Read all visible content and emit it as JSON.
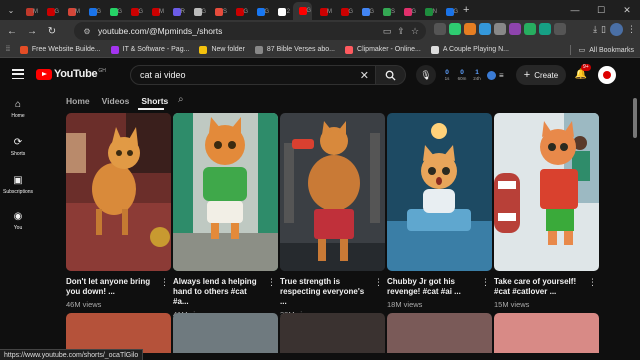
{
  "browser": {
    "tabs": [
      {
        "color": "#c0392b",
        "badge": "M"
      },
      {
        "color": "#cc0000",
        "badge": "G"
      },
      {
        "color": "#d44638",
        "badge": "M"
      },
      {
        "color": "#1a73e8",
        "badge": "G"
      },
      {
        "color": "#25d366",
        "badge": "G"
      },
      {
        "color": "#cc0000",
        "badge": "G"
      },
      {
        "color": "#cc0000",
        "badge": "M"
      },
      {
        "color": "#6c5ce7",
        "badge": "R"
      },
      {
        "color": "#bbbbbb",
        "badge": "G"
      },
      {
        "color": "#e74c3c",
        "badge": "S"
      },
      {
        "color": "#cc0000",
        "badge": "G"
      },
      {
        "color": "#1877f2",
        "badge": "G"
      },
      {
        "color": "#ffffff",
        "badge": "2"
      },
      {
        "color": "#ff0000",
        "badge": "G",
        "active": true
      },
      {
        "color": "#cc0000",
        "badge": "M"
      },
      {
        "color": "#cc0000",
        "badge": "G"
      },
      {
        "color": "#4285f4",
        "badge": "G"
      },
      {
        "color": "#34a853",
        "badge": "S"
      },
      {
        "color": "#e1306c",
        "badge": "G"
      },
      {
        "color": "#1e8e3e",
        "badge": "N"
      },
      {
        "color": "#1a73e8",
        "badge": "G"
      }
    ],
    "url": "youtube.com/@Mpminds_/shorts",
    "bookmarks": [
      {
        "label": "Free Website Builde...",
        "color": "#e44d26"
      },
      {
        "label": "IT & Software - Pag...",
        "color": "#a435f0"
      },
      {
        "label": "New folder",
        "color": "#f4c20d"
      },
      {
        "label": "87 Bible Verses abo...",
        "color": "#888888"
      },
      {
        "label": "Clipmaker - Online...",
        "color": "#ff5a5f"
      },
      {
        "label": "A Couple Playing N...",
        "color": "#dddddd"
      }
    ],
    "all_bookmarks": "All Bookmarks",
    "status_url": "https://www.youtube.com/shorts/_ocaTlGilo"
  },
  "youtube": {
    "logo_text": "YouTube",
    "logo_country": "GH",
    "search_query": "cat ai video",
    "stats": [
      {
        "value": "0",
        "label": "1s"
      },
      {
        "value": "0",
        "label": "60m"
      },
      {
        "value": "1",
        "label": "24h"
      }
    ],
    "create_label": "Create",
    "notification_count": "9+",
    "guide": [
      {
        "label": "Home",
        "icon": "home-icon"
      },
      {
        "label": "Shorts",
        "icon": "shorts-icon"
      },
      {
        "label": "Subscriptions",
        "icon": "subscriptions-icon"
      },
      {
        "label": "You",
        "icon": "you-icon"
      }
    ],
    "channel_tabs": [
      {
        "label": "Home"
      },
      {
        "label": "Videos"
      },
      {
        "label": "Shorts",
        "active": true
      }
    ],
    "shorts": [
      {
        "title": "Don't let anyone bring you down! ...",
        "views": "46M views"
      },
      {
        "title": "Always lend a helping hand to others #cat #a...",
        "views": "41M views"
      },
      {
        "title": "True strength is respecting everyone's ...",
        "views": "33M views"
      },
      {
        "title": "Chubby Jr got his revenge! #cat #ai ...",
        "views": "18M views"
      },
      {
        "title": "Take care of yourself! #cat #catlover ...",
        "views": "15M views"
      }
    ]
  }
}
